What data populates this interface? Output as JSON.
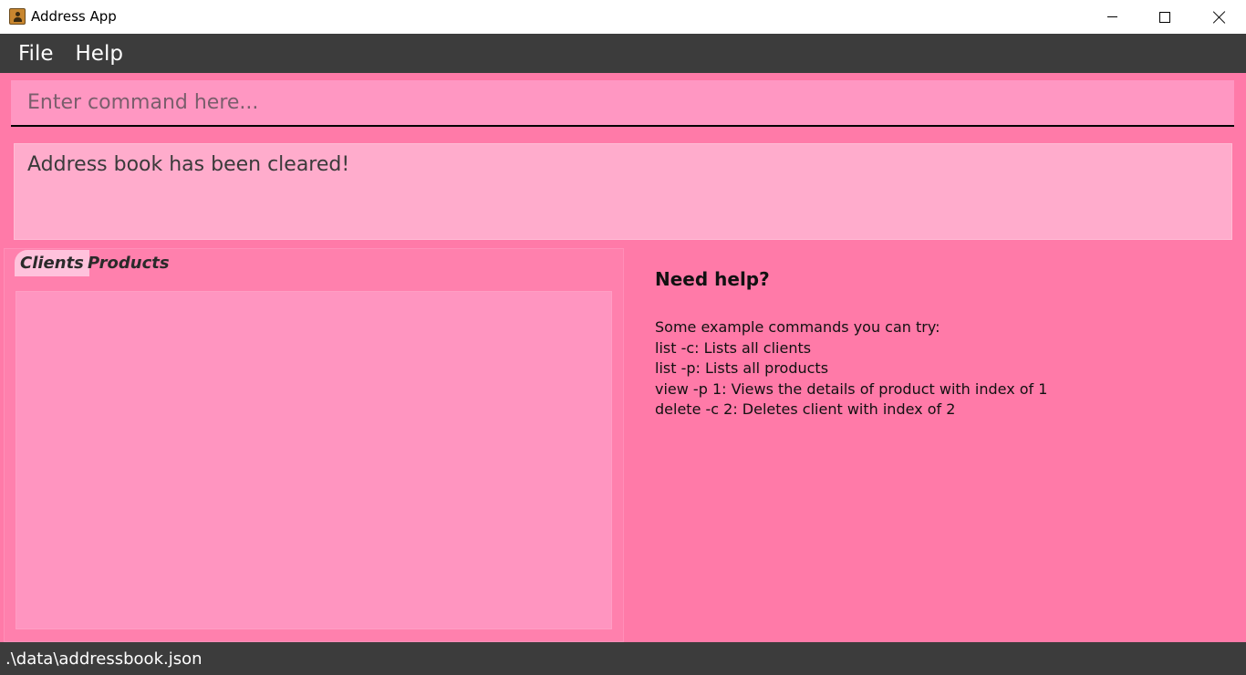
{
  "window": {
    "title": "Address App",
    "icon": "address-book-icon"
  },
  "menu": {
    "items": [
      "File",
      "Help"
    ]
  },
  "command": {
    "placeholder": "Enter command here...",
    "value": ""
  },
  "result": {
    "text": "Address book has been cleared!"
  },
  "tabs": {
    "clients": "Clients",
    "products": "Products",
    "selected": "Clients"
  },
  "help": {
    "title": "Need help?",
    "lines": [
      "Some example commands you can try:",
      "list -c: Lists all clients",
      "list -p: Lists all products",
      "view -p 1: Views the details of product with index of 1",
      "delete -c 2: Deletes client with index of 2"
    ]
  },
  "status": {
    "file_path": ".\\data\\addressbook.json"
  },
  "colors": {
    "background": "#ff7aa8",
    "menubar": "#3c3c3c",
    "command_box": "#ff97c2",
    "result_box": "#ffaccc",
    "list_area": "#ff95c0",
    "selected_tab": "#ffc2dc"
  }
}
